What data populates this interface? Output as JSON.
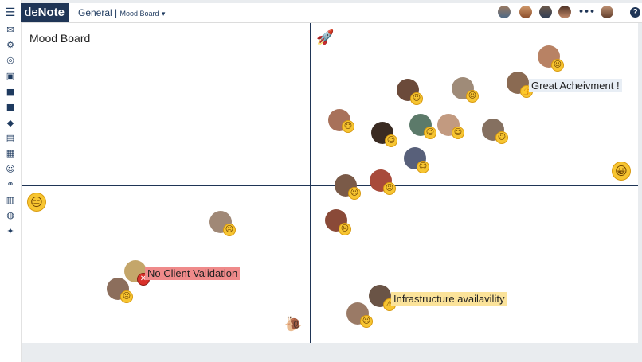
{
  "app": {
    "logo_light": "de",
    "logo_bold": "Note"
  },
  "breadcrumb": {
    "workspace": "General",
    "separator": "|",
    "page": "Mood Board",
    "caret": "▾"
  },
  "toolbar": {
    "more_label": "•••",
    "help_label": "?"
  },
  "board": {
    "title": "Mood Board"
  },
  "notes": [
    {
      "label": "Great Acheivment !",
      "color": "#e8eef5"
    },
    {
      "label": "No Client Validation",
      "color": "#ef8a8a"
    },
    {
      "label": "Infrastructure availavility",
      "color": "#fbe39a"
    }
  ],
  "icons": {
    "rocket": "🚀",
    "snail": "🐌",
    "happy": "😀",
    "meh": "😑",
    "smile": "☺",
    "sad": "☹",
    "angry": "✕",
    "warning": "⚠",
    "thumbs": "👍"
  }
}
